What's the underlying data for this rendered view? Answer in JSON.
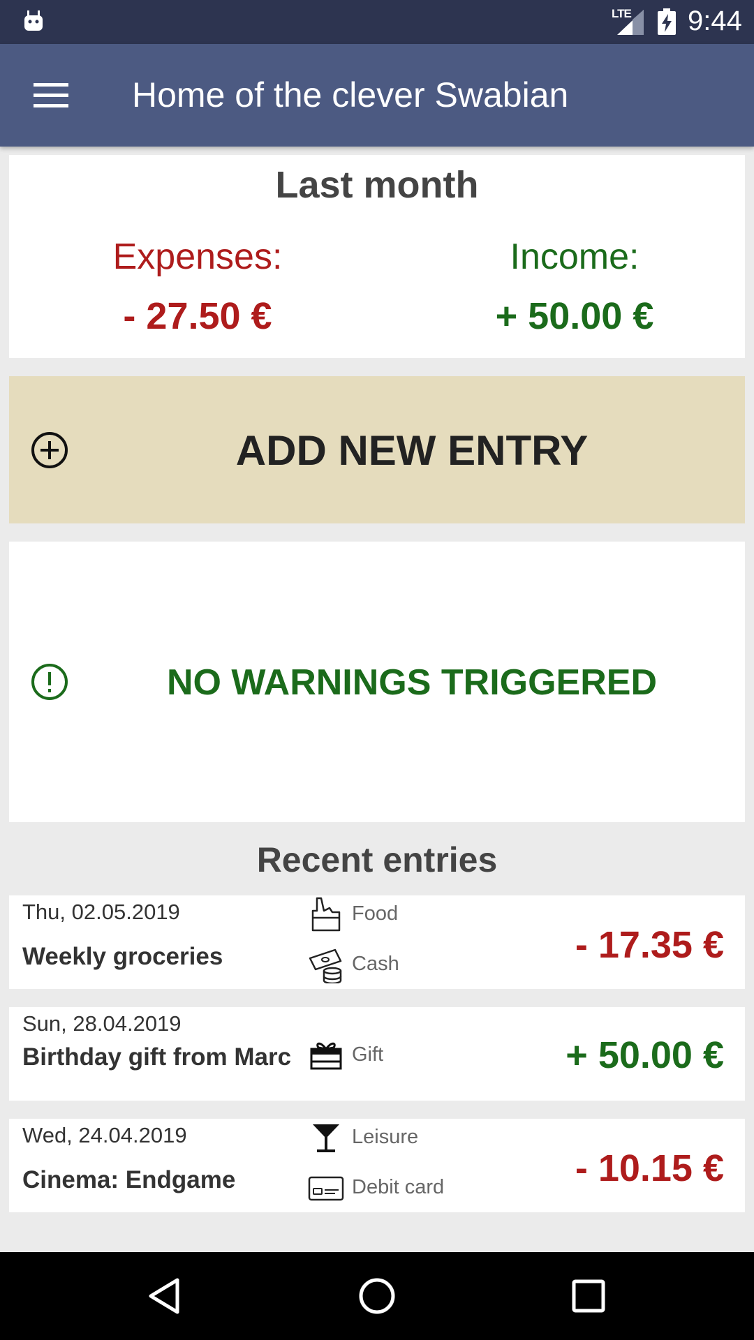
{
  "status_bar": {
    "time": "9:44",
    "network": "LTE",
    "icons": [
      "android-icon",
      "signal-icon",
      "battery-charging-icon"
    ]
  },
  "app_bar": {
    "title": "Home of the clever Swabian",
    "menu_icon": "hamburger-menu-icon"
  },
  "summary": {
    "period": "Last month",
    "expenses_label": "Expenses:",
    "expenses_value": "- 27.50 €",
    "income_label": "Income:",
    "income_value": "+ 50.00 €"
  },
  "add_entry": {
    "label": "ADD NEW ENTRY",
    "icon": "add-circle-icon"
  },
  "warnings": {
    "label": "NO WARNINGS TRIGGERED",
    "icon": "alert-circle-icon"
  },
  "recent": {
    "title": "Recent entries",
    "entries": [
      {
        "date": "Thu, 02.05.2019",
        "description": "Weekly groceries",
        "category": "Food",
        "category_icon": "food-bag-icon",
        "payment": "Cash",
        "payment_icon": "cash-icon",
        "amount": "- 17.35 €",
        "sign": "negative"
      },
      {
        "date": "Sun, 28.04.2019",
        "description": "Birthday gift from Marc",
        "category": "Gift",
        "category_icon": "gift-icon",
        "amount": "+ 50.00 €",
        "sign": "positive"
      },
      {
        "date": "Wed, 24.04.2019",
        "description": "Cinema: Endgame",
        "category": "Leisure",
        "category_icon": "cocktail-glass-icon",
        "payment": "Debit card",
        "payment_icon": "debit-card-icon",
        "amount": "- 10.15 €",
        "sign": "negative"
      }
    ]
  },
  "colors": {
    "status_bar": "#2d3450",
    "app_bar": "#4c5a82",
    "expense": "#ae1c1c",
    "income": "#1b6b1b",
    "add_entry_bg": "#e5dcbd",
    "background": "#ebebeb"
  },
  "nav_bar": {
    "icons": [
      "back-icon",
      "home-icon",
      "recents-icon"
    ]
  }
}
